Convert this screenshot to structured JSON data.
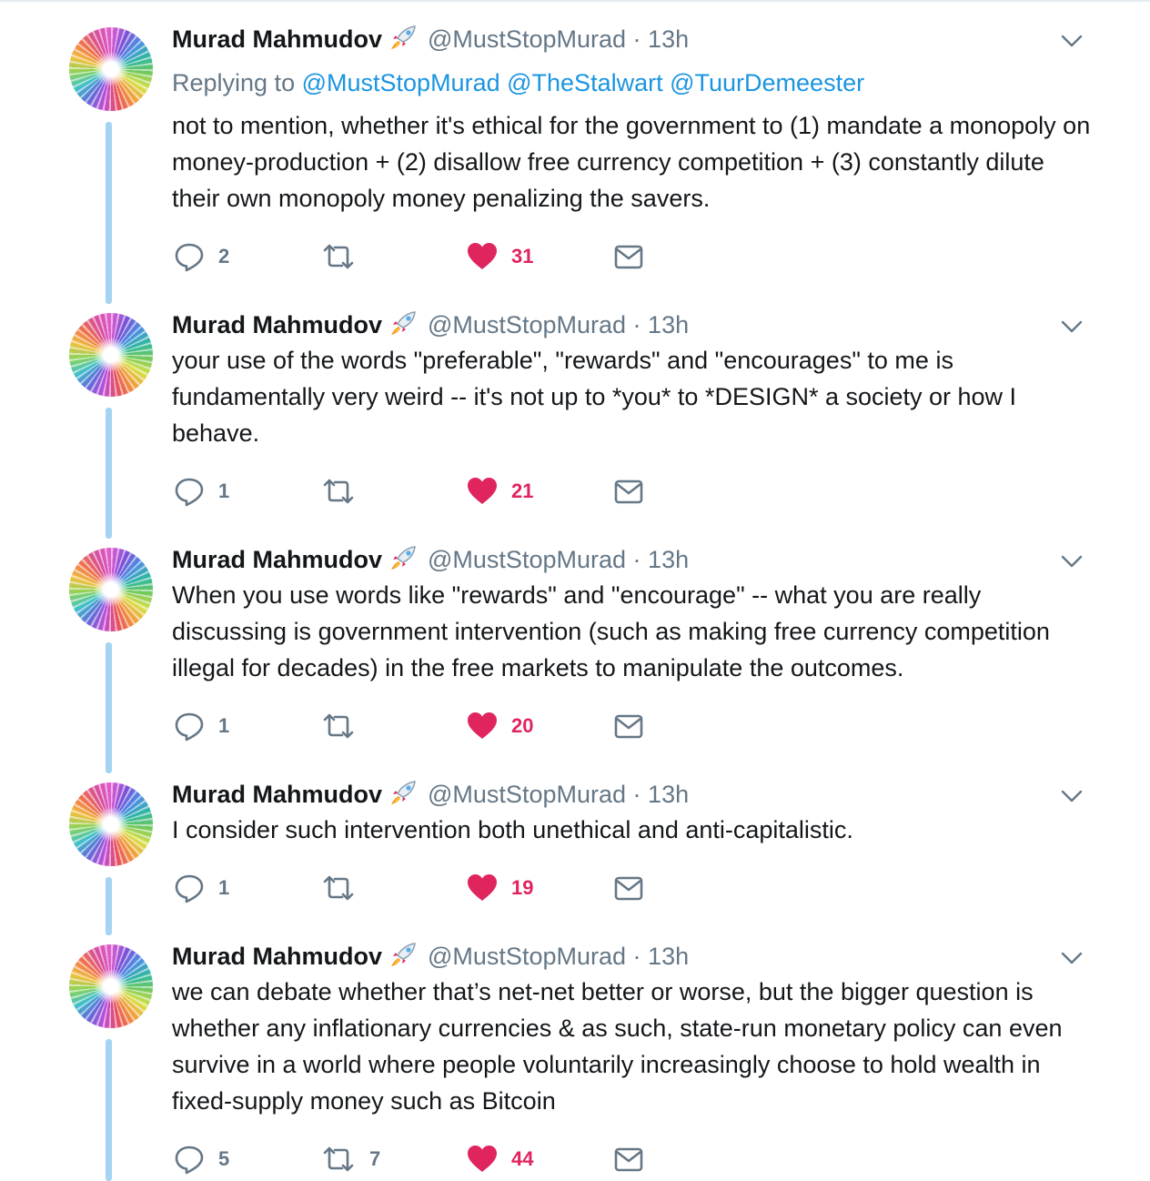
{
  "colors": {
    "link": "#1b95e0",
    "muted": "#657786",
    "like": "#e0245e",
    "thread_line": "#a4d4f2",
    "text": "#14171a"
  },
  "icons": {
    "avatar": "avatar-image",
    "badge": "rocket-emoji-icon",
    "menu": "chevron-down-icon",
    "reply": "reply-icon",
    "retweet": "retweet-icon",
    "like": "heart-icon",
    "dm": "envelope-icon"
  },
  "tweets": [
    {
      "name": "Murad Mahmudov",
      "handle": "@MustStopMurad",
      "separator": "·",
      "time": "13h",
      "replying_prefix": "Replying to",
      "replying_to": [
        "@MustStopMurad",
        "@TheStalwart",
        "@TuurDemeester"
      ],
      "text": "not to mention, whether it's ethical for the government to (1) mandate a monopoly on money-production + (2) disallow free currency competition + (3) constantly dilute their own monopoly money penalizing the savers.",
      "replies": "2",
      "retweets": "",
      "likes": "31"
    },
    {
      "name": "Murad Mahmudov",
      "handle": "@MustStopMurad",
      "separator": "·",
      "time": "13h",
      "text": "your use of the words \"preferable\", \"rewards\" and \"encourages\" to me is fundamentally very weird -- it's not up to *you* to *DESIGN* a society or how I behave.",
      "replies": "1",
      "retweets": "",
      "likes": "21"
    },
    {
      "name": "Murad Mahmudov",
      "handle": "@MustStopMurad",
      "separator": "·",
      "time": "13h",
      "text": "When you use words like \"rewards\" and \"encourage\" -- what you are really discussing is government intervention (such as making free currency competition illegal for decades) in the free markets to manipulate the outcomes.",
      "replies": "1",
      "retweets": "",
      "likes": "20"
    },
    {
      "name": "Murad Mahmudov",
      "handle": "@MustStopMurad",
      "separator": "·",
      "time": "13h",
      "text": "I consider such intervention both unethical and anti-capitalistic.",
      "replies": "1",
      "retweets": "",
      "likes": "19"
    },
    {
      "name": "Murad Mahmudov",
      "handle": "@MustStopMurad",
      "separator": "·",
      "time": "13h",
      "text": "we can debate whether that’s net-net better or worse, but the bigger question is whether any inflationary currencies & as such, state-run monetary policy can even survive in a world where people voluntarily increasingly choose to hold wealth in fixed-supply money such as Bitcoin",
      "replies": "5",
      "retweets": "7",
      "likes": "44"
    }
  ]
}
